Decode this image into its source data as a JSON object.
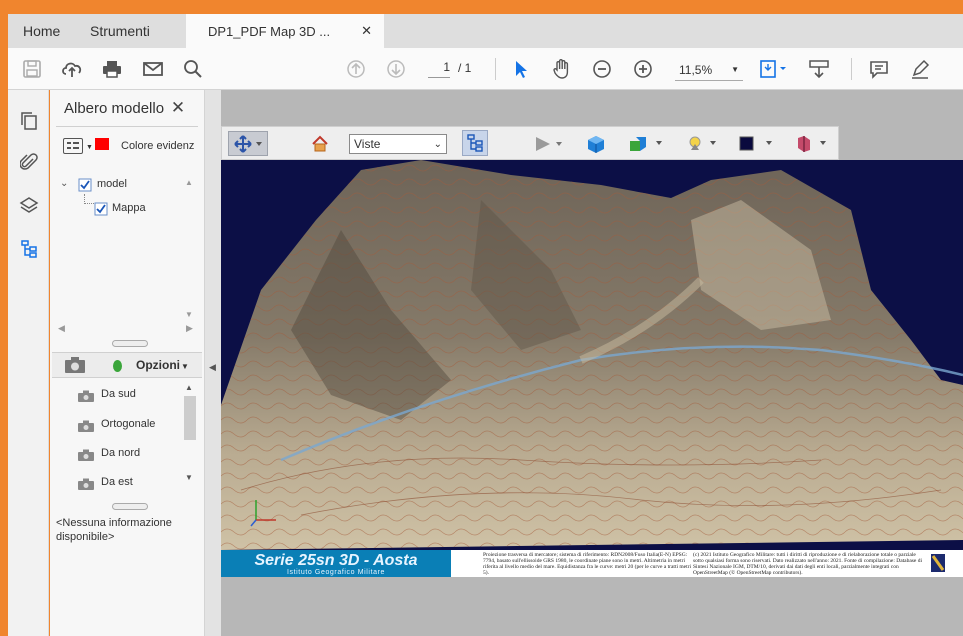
{
  "tabs": {
    "home": "Home",
    "tools": "Strumenti",
    "document": "DP1_PDF Map 3D ..."
  },
  "toolbar": {
    "page_current": "1",
    "page_total": "/ 1",
    "zoom": "11,5%"
  },
  "panel": {
    "title": "Albero modello",
    "highlight_label": "Colore evidenz",
    "tree": [
      {
        "label": "model"
      },
      {
        "label": "Mappa"
      }
    ],
    "options_label": "Opzioni",
    "views": [
      {
        "label": "Da sud"
      },
      {
        "label": "Ortogonale"
      },
      {
        "label": "Da nord"
      },
      {
        "label": "Da est"
      }
    ],
    "no_info": "<Nessuna informazione disponibile>"
  },
  "toolbar3d": {
    "views_select": "Viste"
  },
  "footer": {
    "series_title": "Serie 25sn 3D - Aosta",
    "institute": "Istituto Geografico Militare",
    "projection_text": "Proiezione trasversa di mercatore; sistema di riferimento: RDN2008/Fuso Italia(E-N) EPSG: 7794, basato sull'ellissoide GRS 1980, le coordinate piane sono in metri. Altimetria in metri riferita al livello medio del mare. Equidistanza fra le curve: metri 20 (per le curve a tratti metri 5).",
    "copyright_text": "(c) 2021 Istituto Geografico Militare: tutti i diritti di riproduzione e di rielaborazione totale o parziale sotto qualsiasi forma sono riservati. Dato realizzato nell'anno: 2021. Fonte di compilazione: Database di Sintesi Nazionale IGM, DTM/10, derivati dai dati degli enti locali, parzialmente integrati con OpenStreetMap (© OpenStreetMap contributors)."
  },
  "colors": {
    "accent": "#f0852e",
    "highlight": "#ff0000",
    "blue": "#1473e6",
    "map_bg": "#0c0f46"
  }
}
